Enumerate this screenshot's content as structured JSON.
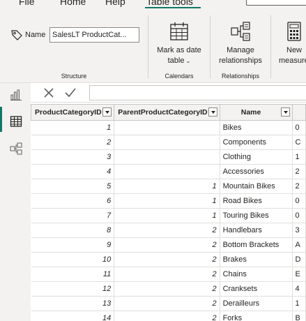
{
  "menu": {
    "file": "File",
    "home": "Home",
    "help": "Help",
    "table_tools": "Table tools"
  },
  "ribbon": {
    "structure": {
      "name_label": "Name",
      "name_value": "SalesLT ProductCat...",
      "group_label": "Structure"
    },
    "calendars": {
      "mark_as_date_line1": "Mark as date",
      "mark_as_date_line2": "table",
      "group_label": "Calendars"
    },
    "relationships": {
      "manage_line1": "Manage",
      "manage_line2": "relationships",
      "group_label": "Relationships"
    },
    "calculations": {
      "new_line1": "New",
      "new_line2": "measure"
    }
  },
  "grid": {
    "columns": [
      "ProductCategoryID",
      "ParentProductCategoryID",
      "Name"
    ],
    "rows": [
      {
        "id": "1",
        "parent": "",
        "name": "Bikes",
        "extra": "0"
      },
      {
        "id": "2",
        "parent": "",
        "name": "Components",
        "extra": "C"
      },
      {
        "id": "3",
        "parent": "",
        "name": "Clothing",
        "extra": "1"
      },
      {
        "id": "4",
        "parent": "",
        "name": "Accessories",
        "extra": "2"
      },
      {
        "id": "5",
        "parent": "1",
        "name": "Mountain Bikes",
        "extra": "2"
      },
      {
        "id": "6",
        "parent": "1",
        "name": "Road Bikes",
        "extra": "0"
      },
      {
        "id": "7",
        "parent": "1",
        "name": "Touring Bikes",
        "extra": "0"
      },
      {
        "id": "8",
        "parent": "2",
        "name": "Handlebars",
        "extra": "3"
      },
      {
        "id": "9",
        "parent": "2",
        "name": "Bottom Brackets",
        "extra": "A"
      },
      {
        "id": "10",
        "parent": "2",
        "name": "Brakes",
        "extra": "D"
      },
      {
        "id": "11",
        "parent": "2",
        "name": "Chains",
        "extra": "E"
      },
      {
        "id": "12",
        "parent": "2",
        "name": "Cranksets",
        "extra": "4"
      },
      {
        "id": "13",
        "parent": "2",
        "name": "Derailleurs",
        "extra": "1"
      },
      {
        "id": "14",
        "parent": "2",
        "name": "Forks",
        "extra": "B"
      }
    ]
  },
  "colors": {
    "accent": "#117865",
    "ribbon_bg": "#f3f2f1"
  },
  "icons": [
    "tag-icon",
    "calendar-icon",
    "relationships-icon",
    "calculator-icon",
    "report-view-icon",
    "table-view-icon",
    "model-view-icon",
    "close-icon",
    "check-icon"
  ]
}
